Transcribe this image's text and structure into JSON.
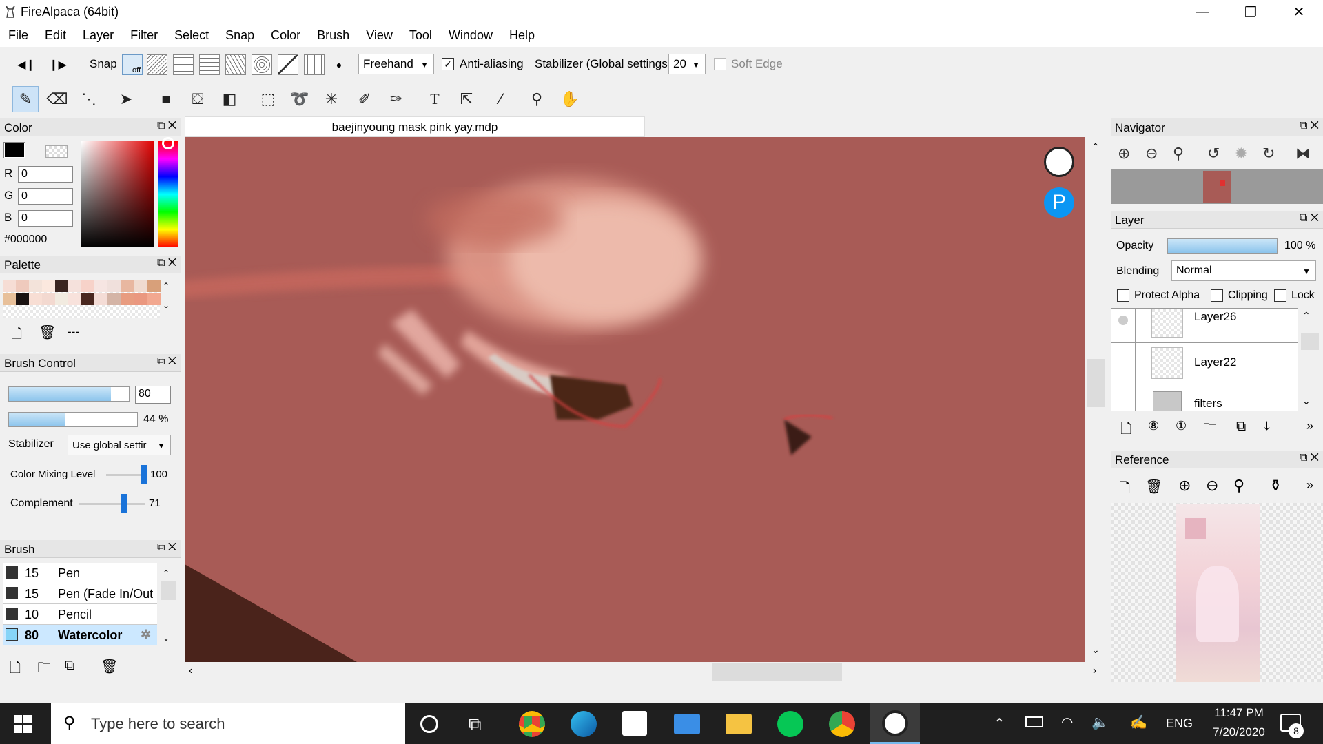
{
  "window": {
    "title": "FireAlpaca (64bit)"
  },
  "menu": [
    "File",
    "Edit",
    "Layer",
    "Filter",
    "Select",
    "Snap",
    "Color",
    "Brush",
    "View",
    "Tool",
    "Window",
    "Help"
  ],
  "toolbar": {
    "snap_label": "Snap",
    "snap_off": "off",
    "brush_mode": "Freehand",
    "antialias_label": "Anti-aliasing",
    "stabilizer_label": "Stabilizer (Global settings)",
    "stabilizer_value": "20",
    "soft_edge_label": "Soft Edge"
  },
  "document": {
    "tab_name": "baejinyoung mask pink yay.mdp"
  },
  "color_panel": {
    "title": "Color",
    "r_label": "R",
    "r": "0",
    "g_label": "G",
    "g": "0",
    "b_label": "B",
    "b": "0",
    "hex": "#000000",
    "foreground": "#000000"
  },
  "palette_panel": {
    "title": "Palette",
    "extra": "---",
    "swatches": [
      "#f6ddd5",
      "#efcabd",
      "#f3e3da",
      "#fbe8de",
      "#3a2520",
      "#f5e1dc",
      "#f7d2c9",
      "#f6e5e2",
      "#f0e0dc",
      "#e8b7a0",
      "#f0dbd0",
      "#d8a07a",
      "#e8c09a",
      "#1a1211",
      "#f8ded4",
      "#f3d9d0",
      "#f2ebe0",
      "#f8e2dc",
      "#4a2820",
      "#f4dcd6",
      "#d4b4a6",
      "#e89c80",
      "#ea9880",
      "#f2a890"
    ]
  },
  "brush_control": {
    "title": "Brush Control",
    "size": "80",
    "size_fraction": 0.85,
    "opacity": "44 %",
    "opacity_fraction": 0.44,
    "stabilizer_label": "Stabilizer",
    "stabilizer_value": "Use global settir",
    "color_mixing_label": "Color Mixing Level",
    "color_mixing_value": "100",
    "complement_label": "Complement",
    "complement_value": "71"
  },
  "brush_panel": {
    "title": "Brush",
    "items": [
      {
        "size": "15",
        "name": "Pen"
      },
      {
        "size": "15",
        "name": "Pen (Fade In/Out"
      },
      {
        "size": "10",
        "name": "Pencil"
      },
      {
        "size": "80",
        "name": "Watercolor"
      }
    ]
  },
  "navigator": {
    "title": "Navigator"
  },
  "layer_panel": {
    "title": "Layer",
    "opacity_label": "Opacity",
    "opacity_value": "100 %",
    "opacity_fraction": 1.0,
    "blending_label": "Blending",
    "blending_value": "Normal",
    "protect_alpha": "Protect Alpha",
    "clipping": "Clipping",
    "lock": "Lock",
    "layers": [
      "Layer26",
      "Layer22",
      "filters"
    ]
  },
  "reference": {
    "title": "Reference"
  },
  "taskbar": {
    "search_placeholder": "Type here to search",
    "language": "ENG",
    "time": "11:47 PM",
    "date": "7/20/2020",
    "notifications": "8"
  }
}
